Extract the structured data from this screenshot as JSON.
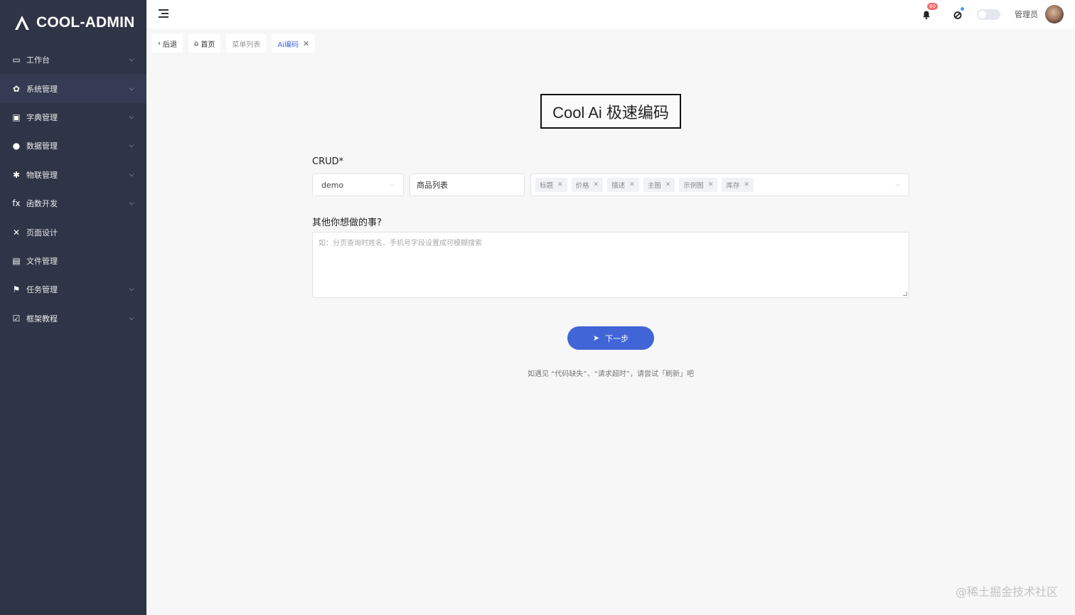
{
  "app": {
    "logo_text": "COOL-ADMIN"
  },
  "sidebar": {
    "items": [
      {
        "label": "工作台",
        "icon": "monitor-icon",
        "has_children": true
      },
      {
        "label": "系统管理",
        "icon": "gear-icon",
        "has_children": true,
        "active": true
      },
      {
        "label": "字典管理",
        "icon": "book-icon",
        "has_children": true
      },
      {
        "label": "数据管理",
        "icon": "data-icon",
        "has_children": true
      },
      {
        "label": "物联管理",
        "icon": "iot-icon",
        "has_children": true
      },
      {
        "label": "函数开发",
        "icon": "function-icon",
        "has_children": true
      },
      {
        "label": "页面设计",
        "icon": "design-icon",
        "has_children": false
      },
      {
        "label": "文件管理",
        "icon": "file-icon",
        "has_children": false
      },
      {
        "label": "任务管理",
        "icon": "flag-icon",
        "has_children": true
      },
      {
        "label": "框架教程",
        "icon": "check-square-icon",
        "has_children": true
      }
    ]
  },
  "topbar": {
    "notification_count": "60",
    "username": "管理员"
  },
  "tabs": [
    {
      "label": "后退",
      "icon": "back-icon"
    },
    {
      "label": "首页",
      "icon": "home-icon"
    },
    {
      "label": "菜单列表"
    },
    {
      "label": "Ai编码",
      "active": true
    }
  ],
  "main": {
    "title": "Cool Ai 极速编码",
    "crud_label": "CRUD*",
    "module_select": "demo",
    "name_input": "商品列表",
    "fields": [
      "标题",
      "价格",
      "描述",
      "主图",
      "示例图",
      "库存"
    ],
    "other_label": "其他你想做的事?",
    "other_placeholder": "如：分页查询时姓名、手机号字段设置成可模糊搜索",
    "next_button": "下一步",
    "hint": "如遇见 “代码缺失”、“请求超时”，请尝试「刷新」吧"
  },
  "watermark": "@稀土掘金技术社区",
  "colors": {
    "sidebar_bg": "#2f3447",
    "accent": "#4165d7",
    "badge": "#f56c6c"
  }
}
